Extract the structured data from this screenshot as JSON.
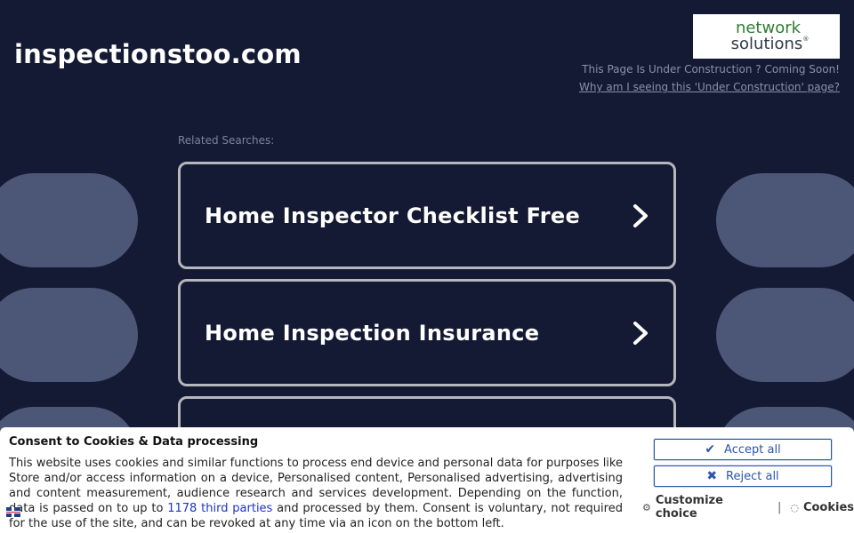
{
  "header": {
    "domain": "inspectionstoo.com",
    "under_construction": "This Page Is Under Construction ? Coming Soon!",
    "why_link": "Why am I seeing this 'Under Construction' page?"
  },
  "logo": {
    "line1": "network",
    "line2": "solutions",
    "mark": "®"
  },
  "related": {
    "label": "Related Searches:",
    "items": [
      {
        "label": "Home Inspector Checklist Free"
      },
      {
        "label": "Home Inspection Insurance"
      },
      {
        "label": ""
      }
    ]
  },
  "consent": {
    "title": "Consent to Cookies & Data processing",
    "body_part1": "This website uses cookies and similar functions to process end device and personal data for purposes like Store and/or access information on a device, Personalised content, Personalised advertising, advertising and content measurement, audience research and services development. Depending on the function, data is passed on to up to ",
    "third_parties_link": "1178 third parties",
    "body_part2": " and processed by them. Consent is voluntary, not required for the use of the site, and can be revoked at any time via an icon on the bottom left.",
    "accept_label": "Accept all",
    "reject_label": "Reject all",
    "customize_label": "Customize choice",
    "separator": "|",
    "cookies_label": "Cookies"
  },
  "colors": {
    "background": "#141a33",
    "pill": "#4c5677",
    "button_blue": "#2b56a8",
    "logo_green": "#2e7d32"
  }
}
